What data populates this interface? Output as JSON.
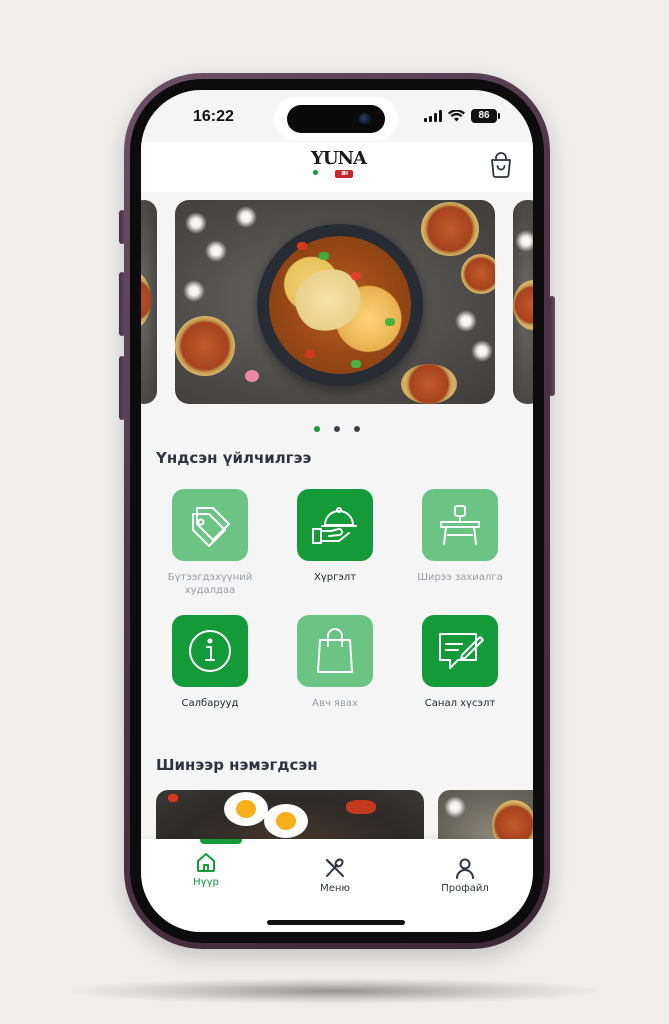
{
  "status_bar": {
    "time": "16:22",
    "battery": "86"
  },
  "header": {
    "logo_text": "YUNA",
    "logo_tag": "ЯН",
    "cart_icon": "shopping-bag-icon"
  },
  "carousel": {
    "slide_count": 3,
    "active_index": 0
  },
  "services": {
    "title": "Үндсэн үйлчилгээ",
    "items": [
      {
        "label": "Бүтээгдэхүүний худалдаа",
        "icon": "price-tag-icon",
        "state": "inactive"
      },
      {
        "label": "Хүргэлт",
        "icon": "delivery-cloche-icon",
        "state": "active"
      },
      {
        "label": "Ширээ захиалга",
        "icon": "table-icon",
        "state": "inactive"
      },
      {
        "label": "Салбарууд",
        "icon": "info-icon",
        "state": "active"
      },
      {
        "label": "Авч явах",
        "icon": "bag-icon",
        "state": "inactive"
      },
      {
        "label": "Санал хүсэлт",
        "icon": "feedback-note-icon",
        "state": "active"
      }
    ]
  },
  "new_items": {
    "title": "Шинээр нэмэгдсэн"
  },
  "tabbar": {
    "items": [
      {
        "label": "Нүүр",
        "icon": "home-icon",
        "active": true
      },
      {
        "label": "Меню",
        "icon": "fork-spoon-icon",
        "active": false
      },
      {
        "label": "Профайл",
        "icon": "user-icon",
        "active": false
      }
    ]
  },
  "colors": {
    "brand_green": "#159a3a",
    "light_green": "#6cc484",
    "muted_text": "#9a9da3",
    "title_text": "#2f3440"
  }
}
